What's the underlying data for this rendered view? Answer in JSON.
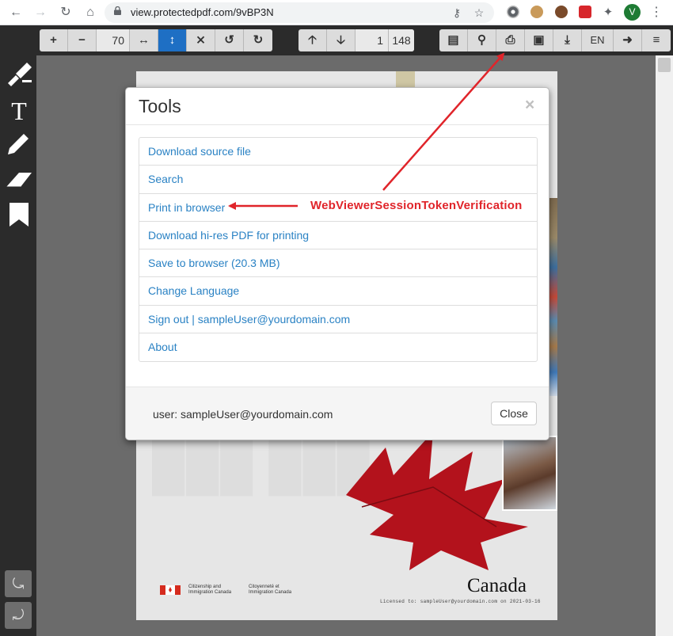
{
  "browser": {
    "url": "view.protectedpdf.com/9vBP3N",
    "profile_initial": "V"
  },
  "toolbar": {
    "zoom_value": "70",
    "page_current": "1",
    "page_total": "148",
    "language": "EN"
  },
  "modal": {
    "title": "Tools",
    "close_x": "×",
    "items": [
      "Download source file",
      "Search",
      "Print in browser",
      "Download hi-res PDF for printing",
      "Save to browser (20.3 MB)",
      "Change Language",
      "Sign out | sampleUser@yourdomain.com",
      "About"
    ],
    "footer_user": "user: sampleUser@yourdomain.com",
    "close_button": "Close"
  },
  "annotation": {
    "label": "WebViewerSessionTokenVerification",
    "color": "#e0242a"
  },
  "document": {
    "dept_en": "Citizenship and Immigration Canada",
    "dept_fr": "Citoyenneté et Immigration Canada",
    "wordmark": "Canada",
    "license_line": "Licensed to: sampleUser@yourdomain.com on 2021-03-16"
  },
  "colors": {
    "link": "#2a82c4",
    "toolbar_bg": "#2b2b2b",
    "active_button": "#1e6fc4"
  }
}
